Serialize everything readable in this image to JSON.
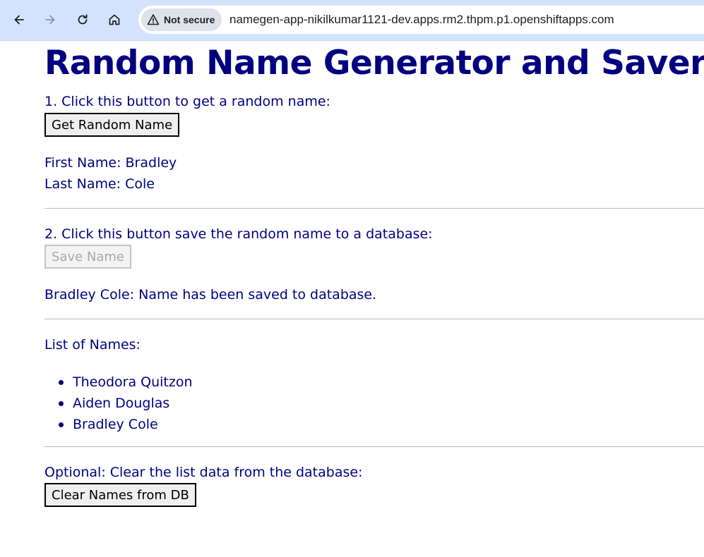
{
  "browser": {
    "security_label": "Not secure",
    "url": "namegen-app-nikilkumar1121-dev.apps.rm2.thpm.p1.openshiftapps.com"
  },
  "page": {
    "title": "Random Name Generator and Saver",
    "step1_text": "1. Click this button to get a random name:",
    "get_name_button": "Get Random Name",
    "first_name": "First Name: Bradley",
    "last_name": "Last Name: Cole",
    "step2_text": "2. Click this button save the random name to a database:",
    "save_name_button": "Save Name",
    "save_status": "Bradley Cole: Name has been saved to database.",
    "list_heading": "List of Names:",
    "names": [
      "Theodora Quitzon",
      "Aiden Douglas",
      "Bradley Cole"
    ],
    "optional_text": "Optional: Clear the list data from the database:",
    "clear_button": "Clear Names from DB"
  },
  "colors": {
    "text": "#000080",
    "toolbar": "#d3e3fd"
  }
}
